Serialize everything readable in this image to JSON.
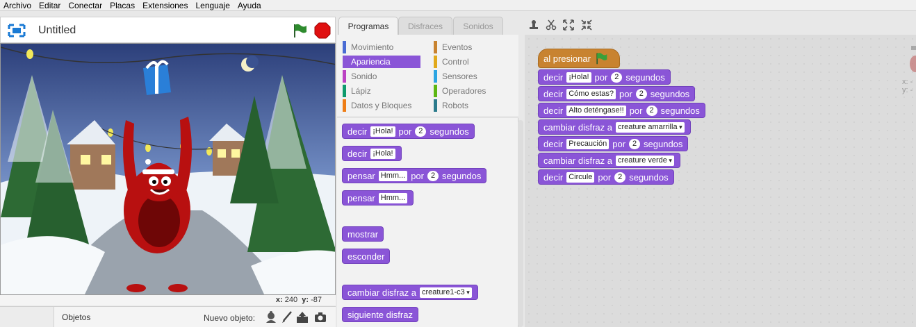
{
  "menu": [
    "Archivo",
    "Editar",
    "Conectar",
    "Placas",
    "Extensiones",
    "Lenguaje",
    "Ayuda"
  ],
  "stage": {
    "title": "Untitled",
    "coords": {
      "x_label": "x:",
      "x_value": "240",
      "y_label": "y:",
      "y_value": "-87"
    }
  },
  "sprites": {
    "objetos_label": "Objetos",
    "nuevo_label": "Nuevo objeto:"
  },
  "tabs": [
    "Programas",
    "Disfraces",
    "Sonidos"
  ],
  "categories": {
    "left": [
      {
        "label": "Movimiento",
        "color": "#4a6cd4"
      },
      {
        "label": "Apariencia",
        "color": "#8a55d7"
      },
      {
        "label": "Sonido",
        "color": "#bb42c3"
      },
      {
        "label": "Lápiz",
        "color": "#0e9a6c"
      },
      {
        "label": "Datos y Bloques",
        "color": "#ee7d16"
      }
    ],
    "right": [
      {
        "label": "Eventos",
        "color": "#c88330"
      },
      {
        "label": "Control",
        "color": "#e1a91a"
      },
      {
        "label": "Sensores",
        "color": "#2ca5e2"
      },
      {
        "label": "Operadores",
        "color": "#5cb712"
      },
      {
        "label": "Robots",
        "color": "#2b7b8c"
      }
    ]
  },
  "palette_blocks": {
    "b1": {
      "w1": "decir",
      "i1": "¡Hola!",
      "w2": "por",
      "n1": "2",
      "w3": "segundos"
    },
    "b2": {
      "w1": "decir",
      "i1": "¡Hola!"
    },
    "b3": {
      "w1": "pensar",
      "i1": "Hmm...",
      "w2": "por",
      "n1": "2",
      "w3": "segundos"
    },
    "b4": {
      "w1": "pensar",
      "i1": "Hmm..."
    },
    "b5": {
      "w1": "mostrar"
    },
    "b6": {
      "w1": "esconder"
    },
    "b7": {
      "w1": "cambiar disfraz a",
      "d1": "creature1-c3"
    },
    "b8": {
      "w1": "siguiente disfraz"
    }
  },
  "script": {
    "hat": "al presionar",
    "s1": {
      "w1": "decir",
      "i1": "¡Hola!",
      "w2": "por",
      "n1": "2",
      "w3": "segundos"
    },
    "s2": {
      "w1": "decir",
      "i1": "Cómo estas?",
      "w2": "por",
      "n1": "2",
      "w3": "segundos"
    },
    "s3": {
      "w1": "decir",
      "i1": "Alto deténgase!!",
      "w2": "por",
      "n1": "2",
      "w3": "segundos"
    },
    "s4": {
      "w1": "cambiar disfraz a",
      "d1": "creature amarrilla"
    },
    "s5": {
      "w1": "decir",
      "i1": "Precaución",
      "w2": "por",
      "n1": "2",
      "w3": "segundos"
    },
    "s6": {
      "w1": "cambiar disfraz a",
      "d1": "creature verde"
    },
    "s7": {
      "w1": "decir",
      "i1": "Circule",
      "w2": "por",
      "n1": "2",
      "w3": "segundos"
    }
  },
  "sprite_info": {
    "x": "x:",
    "y": "y:",
    "dash": "-"
  },
  "colors": {
    "looks": "#8a55d7",
    "events": "#c88330",
    "flag": "#2e8b2e",
    "stop": "#e01010"
  }
}
